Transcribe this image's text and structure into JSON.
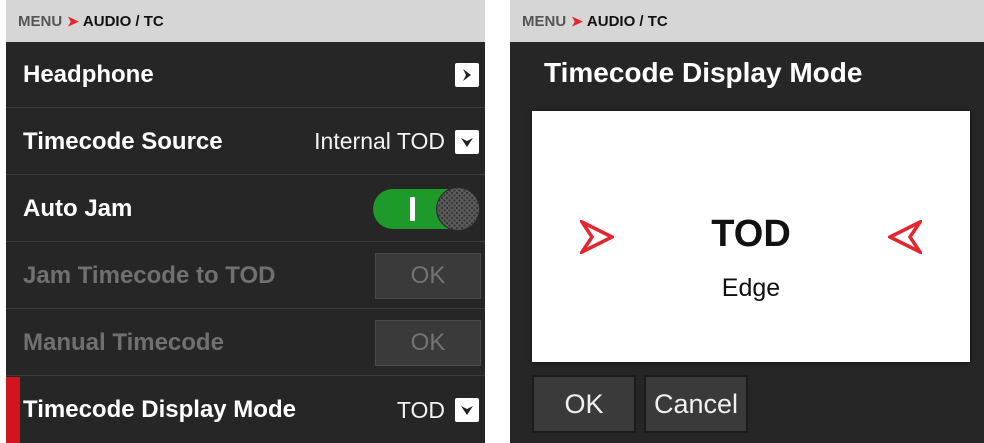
{
  "left_panel": {
    "breadcrumb": {
      "root": "MENU",
      "current": "AUDIO / TC"
    },
    "rows": [
      {
        "label": "Headphone"
      },
      {
        "label": "Timecode Source",
        "value": "Internal TOD"
      },
      {
        "label": "Auto Jam",
        "toggle_on": true
      },
      {
        "label": "Jam Timecode to TOD",
        "button": "OK",
        "enabled": false
      },
      {
        "label": "Manual Timecode",
        "button": "OK",
        "enabled": false
      },
      {
        "label": "Timecode Display Mode",
        "value": "TOD",
        "selected": true
      }
    ]
  },
  "right_panel": {
    "breadcrumb": {
      "root": "MENU",
      "current": "AUDIO / TC"
    },
    "dialog": {
      "title": "Timecode Display Mode",
      "value_main": "TOD",
      "value_sub": "Edge",
      "ok_label": "OK",
      "cancel_label": "Cancel"
    }
  },
  "icons": {
    "submenu": "chevron-right-icon",
    "dropdown": "chevron-down-icon",
    "prev": "arrow-prev-icon",
    "next": "arrow-next-icon"
  },
  "colors": {
    "accent_red": "#e3262f",
    "toggle_green": "#1e9a2b",
    "panel_bg": "#262626",
    "breadcrumb_bg": "#d6d6d6"
  }
}
